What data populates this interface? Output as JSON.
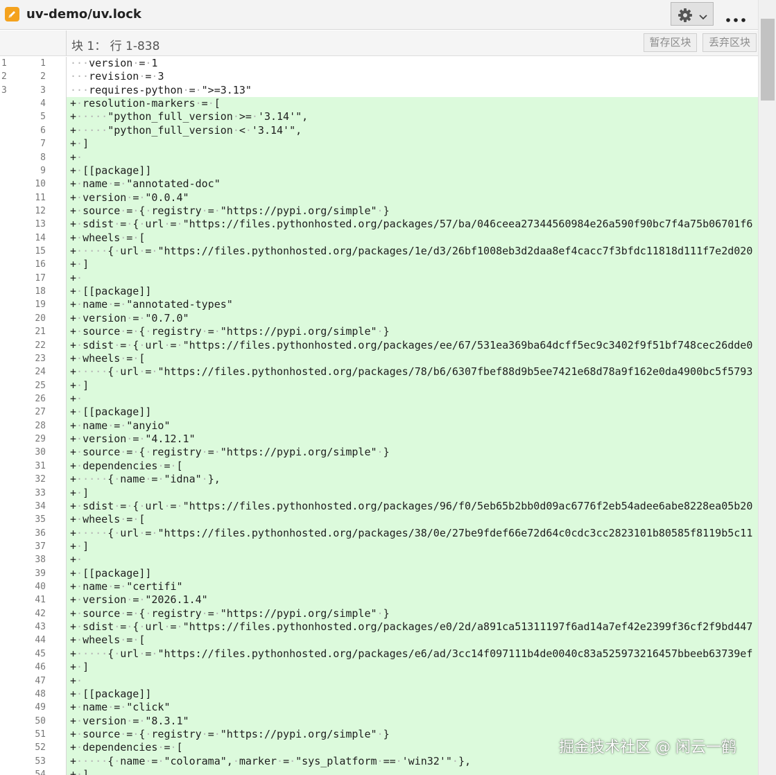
{
  "window": {
    "title": "uv-demo/uv.lock"
  },
  "toolbar": {
    "file_icon": "pencil-file-icon",
    "gear_icon": "gear-icon",
    "chevron_icon": "chevron-down-icon",
    "more_icon": "more-icon"
  },
  "hunk": {
    "info": "块 1： 行 1-838",
    "stage_label": "暂存区块",
    "discard_label": "丢弃区块"
  },
  "colors": {
    "added_bg": "#dcfadc",
    "file_icon": "#f4a21d"
  },
  "lines": [
    {
      "old": "1",
      "new": "1",
      "type": "context",
      "text": "version = 1"
    },
    {
      "old": "2",
      "new": "2",
      "type": "context",
      "text": "revision = 3"
    },
    {
      "old": "3",
      "new": "3",
      "type": "context",
      "text": "requires-python = \">=3.13\""
    },
    {
      "old": "",
      "new": "4",
      "type": "added",
      "text": "resolution-markers = ["
    },
    {
      "old": "",
      "new": "5",
      "type": "added",
      "text": "    \"python_full_version >= '3.14'\","
    },
    {
      "old": "",
      "new": "6",
      "type": "added",
      "text": "    \"python_full_version < '3.14'\","
    },
    {
      "old": "",
      "new": "7",
      "type": "added",
      "text": "]"
    },
    {
      "old": "",
      "new": "8",
      "type": "added",
      "text": ""
    },
    {
      "old": "",
      "new": "9",
      "type": "added",
      "text": "[[package]]"
    },
    {
      "old": "",
      "new": "10",
      "type": "added",
      "text": "name = \"annotated-doc\""
    },
    {
      "old": "",
      "new": "11",
      "type": "added",
      "text": "version = \"0.0.4\""
    },
    {
      "old": "",
      "new": "12",
      "type": "added",
      "text": "source = { registry = \"https://pypi.org/simple\" }"
    },
    {
      "old": "",
      "new": "13",
      "type": "added",
      "text": "sdist = { url = \"https://files.pythonhosted.org/packages/57/ba/046ceea27344560984e26a590f90bc7f4a75b06701f6"
    },
    {
      "old": "",
      "new": "14",
      "type": "added",
      "text": "wheels = ["
    },
    {
      "old": "",
      "new": "15",
      "type": "added",
      "text": "    { url = \"https://files.pythonhosted.org/packages/1e/d3/26bf1008eb3d2daa8ef4cacc7f3bfdc11818d111f7e2d020"
    },
    {
      "old": "",
      "new": "16",
      "type": "added",
      "text": "]"
    },
    {
      "old": "",
      "new": "17",
      "type": "added",
      "text": ""
    },
    {
      "old": "",
      "new": "18",
      "type": "added",
      "text": "[[package]]"
    },
    {
      "old": "",
      "new": "19",
      "type": "added",
      "text": "name = \"annotated-types\""
    },
    {
      "old": "",
      "new": "20",
      "type": "added",
      "text": "version = \"0.7.0\""
    },
    {
      "old": "",
      "new": "21",
      "type": "added",
      "text": "source = { registry = \"https://pypi.org/simple\" }"
    },
    {
      "old": "",
      "new": "22",
      "type": "added",
      "text": "sdist = { url = \"https://files.pythonhosted.org/packages/ee/67/531ea369ba64dcff5ec9c3402f9f51bf748cec26dde0"
    },
    {
      "old": "",
      "new": "23",
      "type": "added",
      "text": "wheels = ["
    },
    {
      "old": "",
      "new": "24",
      "type": "added",
      "text": "    { url = \"https://files.pythonhosted.org/packages/78/b6/6307fbef88d9b5ee7421e68d78a9f162e0da4900bc5f5793"
    },
    {
      "old": "",
      "new": "25",
      "type": "added",
      "text": "]"
    },
    {
      "old": "",
      "new": "26",
      "type": "added",
      "text": ""
    },
    {
      "old": "",
      "new": "27",
      "type": "added",
      "text": "[[package]]"
    },
    {
      "old": "",
      "new": "28",
      "type": "added",
      "text": "name = \"anyio\""
    },
    {
      "old": "",
      "new": "29",
      "type": "added",
      "text": "version = \"4.12.1\""
    },
    {
      "old": "",
      "new": "30",
      "type": "added",
      "text": "source = { registry = \"https://pypi.org/simple\" }"
    },
    {
      "old": "",
      "new": "31",
      "type": "added",
      "text": "dependencies = ["
    },
    {
      "old": "",
      "new": "32",
      "type": "added",
      "text": "    { name = \"idna\" },"
    },
    {
      "old": "",
      "new": "33",
      "type": "added",
      "text": "]"
    },
    {
      "old": "",
      "new": "34",
      "type": "added",
      "text": "sdist = { url = \"https://files.pythonhosted.org/packages/96/f0/5eb65b2bb0d09ac6776f2eb54adee6abe8228ea05b20"
    },
    {
      "old": "",
      "new": "35",
      "type": "added",
      "text": "wheels = ["
    },
    {
      "old": "",
      "new": "36",
      "type": "added",
      "text": "    { url = \"https://files.pythonhosted.org/packages/38/0e/27be9fdef66e72d64c0cdc3cc2823101b80585f8119b5c11"
    },
    {
      "old": "",
      "new": "37",
      "type": "added",
      "text": "]"
    },
    {
      "old": "",
      "new": "38",
      "type": "added",
      "text": ""
    },
    {
      "old": "",
      "new": "39",
      "type": "added",
      "text": "[[package]]"
    },
    {
      "old": "",
      "new": "40",
      "type": "added",
      "text": "name = \"certifi\""
    },
    {
      "old": "",
      "new": "41",
      "type": "added",
      "text": "version = \"2026.1.4\""
    },
    {
      "old": "",
      "new": "42",
      "type": "added",
      "text": "source = { registry = \"https://pypi.org/simple\" }"
    },
    {
      "old": "",
      "new": "43",
      "type": "added",
      "text": "sdist = { url = \"https://files.pythonhosted.org/packages/e0/2d/a891ca51311197f6ad14a7ef42e2399f36cf2f9bd447"
    },
    {
      "old": "",
      "new": "44",
      "type": "added",
      "text": "wheels = ["
    },
    {
      "old": "",
      "new": "45",
      "type": "added",
      "text": "    { url = \"https://files.pythonhosted.org/packages/e6/ad/3cc14f097111b4de0040c83a525973216457bbeeb63739ef"
    },
    {
      "old": "",
      "new": "46",
      "type": "added",
      "text": "]"
    },
    {
      "old": "",
      "new": "47",
      "type": "added",
      "text": ""
    },
    {
      "old": "",
      "new": "48",
      "type": "added",
      "text": "[[package]]"
    },
    {
      "old": "",
      "new": "49",
      "type": "added",
      "text": "name = \"click\""
    },
    {
      "old": "",
      "new": "50",
      "type": "added",
      "text": "version = \"8.3.1\""
    },
    {
      "old": "",
      "new": "51",
      "type": "added",
      "text": "source = { registry = \"https://pypi.org/simple\" }"
    },
    {
      "old": "",
      "new": "52",
      "type": "added",
      "text": "dependencies = ["
    },
    {
      "old": "",
      "new": "53",
      "type": "added",
      "text": "    { name = \"colorama\", marker = \"sys_platform == 'win32'\" },"
    },
    {
      "old": "",
      "new": "54",
      "type": "added",
      "text": "]"
    }
  ],
  "watermark": "掘金技术社区 @ 闲云一鹤"
}
